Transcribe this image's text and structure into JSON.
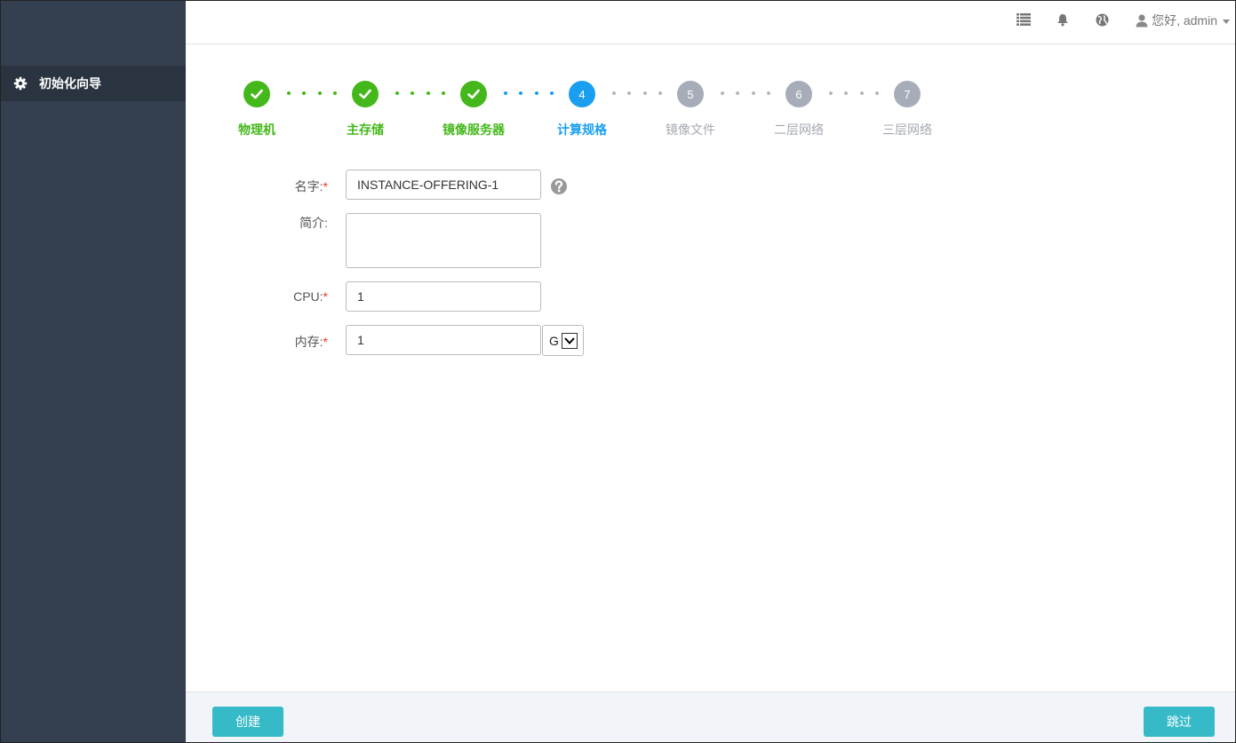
{
  "sidebar": {
    "items": [
      {
        "label": "初始化向导",
        "icon": "gear-icon"
      }
    ]
  },
  "header": {
    "icons": [
      "list-icon",
      "bell-icon",
      "globe-icon"
    ],
    "user_greeting": "您好, admin"
  },
  "wizard": {
    "steps": [
      {
        "label": "物理机",
        "status": "done"
      },
      {
        "label": "主存储",
        "status": "done"
      },
      {
        "label": "镜像服务器",
        "status": "done"
      },
      {
        "label": "计算规格",
        "status": "active",
        "number": "4"
      },
      {
        "label": "镜像文件",
        "status": "todo",
        "number": "5"
      },
      {
        "label": "二层网络",
        "status": "todo",
        "number": "6"
      },
      {
        "label": "三层网络",
        "status": "todo",
        "number": "7"
      }
    ]
  },
  "form": {
    "name_label": "名字:",
    "name_value": "INSTANCE-OFFERING-1",
    "desc_label": "简介:",
    "desc_value": "",
    "cpu_label": "CPU:",
    "cpu_value": "1",
    "memory_label": "内存:",
    "memory_value": "1",
    "memory_unit": "G",
    "required_mark": "*"
  },
  "footer": {
    "create_label": "创建",
    "skip_label": "跳过"
  },
  "colors": {
    "done": "#44b81a",
    "active": "#1a9ff0",
    "todo": "#a7adb8",
    "button": "#36bac8",
    "sidebar": "#343f4f"
  }
}
